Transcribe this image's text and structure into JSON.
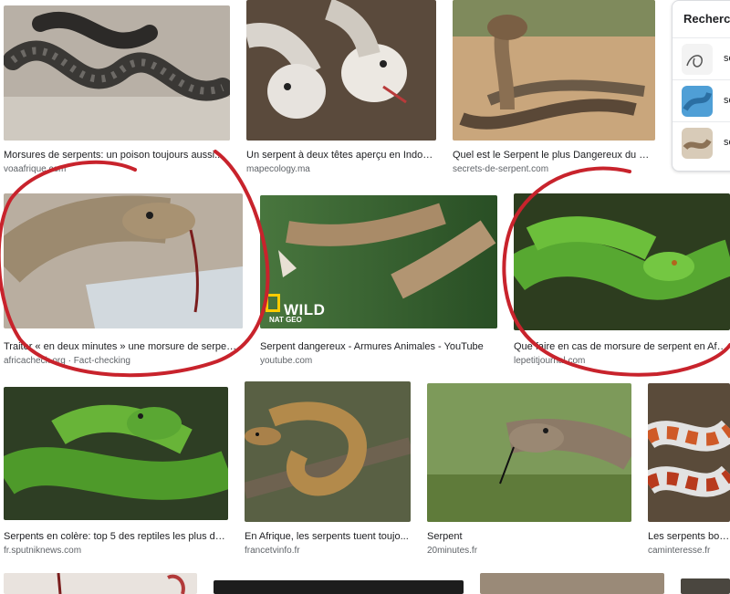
{
  "panel": {
    "title": "Recherch",
    "items": [
      {
        "label": "se"
      },
      {
        "label": "se"
      },
      {
        "label": "se"
      }
    ]
  },
  "results": [
    {
      "caption": "Morsures de serpents: un poison toujours aussi...",
      "source": "voaafrique.com"
    },
    {
      "caption": "Un serpent à deux têtes aperçu en Indon...",
      "source": "mapecology.ma"
    },
    {
      "caption": "Quel est le Serpent le plus Dangereux du Mo...",
      "source": "secrets-de-serpent.com"
    },
    {
      "caption": "Traiter « en deux minutes » une morsure de serpent ...",
      "source": "africacheck.org · Fact-checking"
    },
    {
      "caption": "Serpent dangereux - Armures Animales - YouTube",
      "source": "youtube.com"
    },
    {
      "caption": "Que faire en cas de morsure de serpent en Afrique...",
      "source": "lepetitjournal.com"
    },
    {
      "caption": "Serpents en colère: top 5 des reptiles les plus da...",
      "source": "fr.sputniknews.com"
    },
    {
      "caption": "En Afrique, les serpents tuent toujo...",
      "source": "francetvinfo.fr"
    },
    {
      "caption": "Serpent",
      "source": "20minutes.fr"
    },
    {
      "caption": "Les serpents boive...",
      "source": "caminteresse.fr"
    }
  ],
  "overlay": {
    "natgeo_small": "NAT GEO",
    "natgeo_big": "WILD"
  },
  "colors": {
    "annotation_stroke": "#c8232c",
    "caption_text": "#202124",
    "source_text": "#5f6368"
  }
}
